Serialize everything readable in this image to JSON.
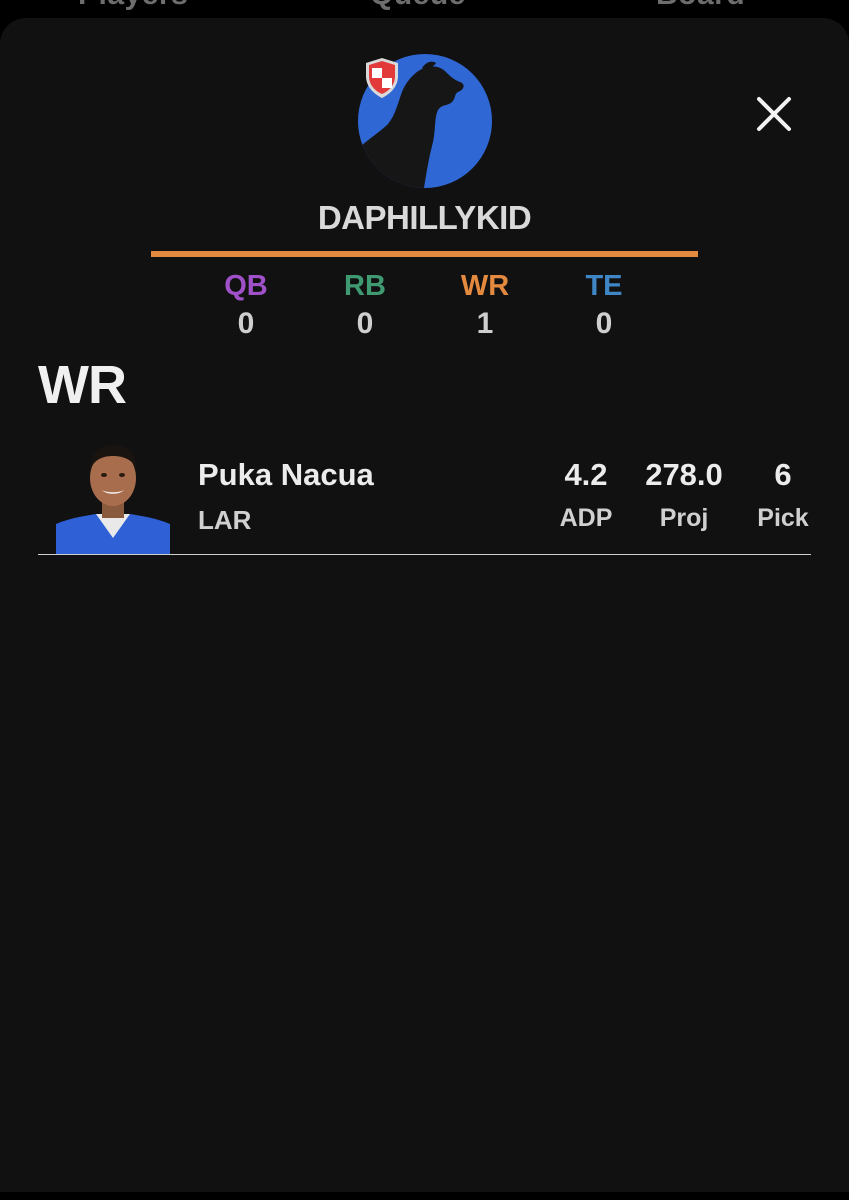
{
  "tabs": [
    "Players",
    "Queue",
    "Board"
  ],
  "user": {
    "username": "DAPHILLYKID",
    "avatar_icon": "dog-silhouette-icon",
    "avatar_color": "#2f67d4",
    "badge_icon": "shield-badge-icon"
  },
  "position_counts": [
    {
      "label": "QB",
      "count": "0",
      "color": "#a050c8"
    },
    {
      "label": "RB",
      "count": "0",
      "color": "#3f9a72"
    },
    {
      "label": "WR",
      "count": "1",
      "color": "#e38a3f"
    },
    {
      "label": "TE",
      "count": "0",
      "color": "#3f86c6"
    }
  ],
  "accent_rule_color": "#e38a3f",
  "section": {
    "title": "WR"
  },
  "players": [
    {
      "name": "Puka Nacua",
      "team": "LAR",
      "adp": "4.2",
      "adp_label": "ADP",
      "proj": "278.0",
      "proj_label": "Proj",
      "pick": "6",
      "pick_label": "Pick"
    }
  ]
}
